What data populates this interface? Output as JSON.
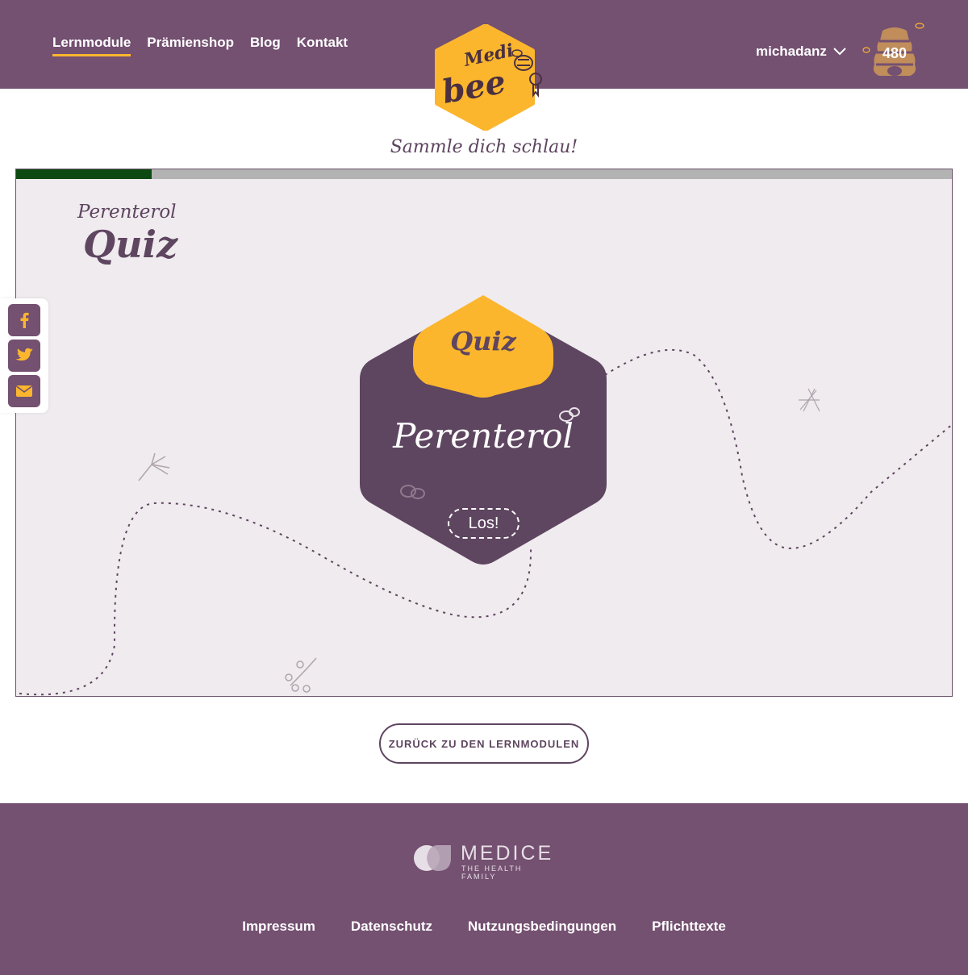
{
  "nav": {
    "items": [
      {
        "label": "Lernmodule",
        "active": true
      },
      {
        "label": "Prämienshop",
        "active": false
      },
      {
        "label": "Blog",
        "active": false
      },
      {
        "label": "Kontakt",
        "active": false
      }
    ]
  },
  "logo": {
    "line1": "Medi",
    "line2": "bee"
  },
  "user": {
    "name": "michadanz",
    "points": "480"
  },
  "tagline": "Sammle dich schlau!",
  "module": {
    "progress": 0.145,
    "subtitle": "Perenterol",
    "title": "Quiz",
    "card_badge": "Quiz",
    "card_title": "Perenterol",
    "start_label": "Los!"
  },
  "share": [
    "facebook-icon",
    "twitter-icon",
    "mail-icon"
  ],
  "back_label": "ZURÜCK ZU DEN LERNMODULEN",
  "footer": {
    "brand": "MEDICE",
    "brand_sub": "THE HEALTH FAMILY",
    "links": [
      "Impressum",
      "Datenschutz",
      "Nutzungsbedingungen",
      "Pflichttexte"
    ]
  },
  "colors": {
    "primary": "#745071",
    "dark": "#5e4560",
    "accent": "#fbb62d",
    "progress": "#0d4a12",
    "panel": "#efebee"
  }
}
